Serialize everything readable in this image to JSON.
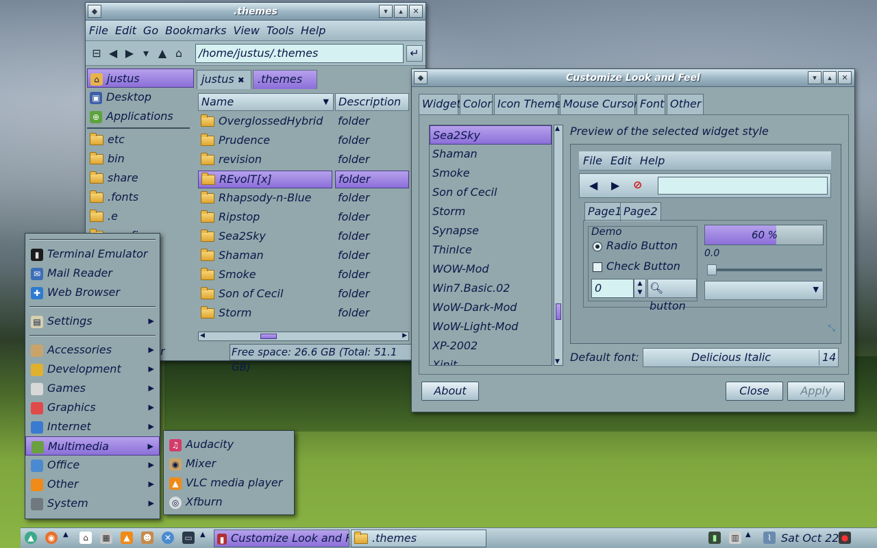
{
  "file_manager": {
    "title": ".themes",
    "menu": [
      "File",
      "Edit",
      "Go",
      "Bookmarks",
      "View",
      "Tools",
      "Help"
    ],
    "location": "/home/justus/.themes",
    "sidebar": [
      {
        "label": "justus",
        "icon": "home-folder-icon",
        "selected": true
      },
      {
        "label": "Desktop",
        "icon": "desktop-icon"
      },
      {
        "label": "Applications",
        "icon": "applications-icon"
      },
      {
        "label": "etc",
        "icon": "folder-icon"
      },
      {
        "label": "bin",
        "icon": "folder-icon"
      },
      {
        "label": "share",
        "icon": "folder-icon"
      },
      {
        "label": ".fonts",
        "icon": "folder-icon"
      },
      {
        "label": ".e",
        "icon": "folder-icon"
      },
      {
        "label": ".config",
        "icon": "folder-icon"
      }
    ],
    "tabs": [
      {
        "label": "justus",
        "close": "✖"
      },
      {
        "label": ".themes",
        "close": "✖"
      }
    ],
    "columns": {
      "name": "Name",
      "description": "Description"
    },
    "rows": [
      {
        "name": "OverglossedHybrid",
        "desc": "folder"
      },
      {
        "name": "Prudence",
        "desc": "folder"
      },
      {
        "name": "revision",
        "desc": "folder"
      },
      {
        "name": "REvolT[x]",
        "desc": "folder",
        "selected": true
      },
      {
        "name": "Rhapsody-n-Blue",
        "desc": "folder"
      },
      {
        "name": "Ripstop",
        "desc": "folder"
      },
      {
        "name": "Sea2Sky",
        "desc": "folder"
      },
      {
        "name": "Shaman",
        "desc": "folder"
      },
      {
        "name": "Smoke",
        "desc": "folder"
      },
      {
        "name": "Son of Cecil",
        "desc": "folder"
      },
      {
        "name": "Storm",
        "desc": "folder"
      }
    ],
    "status_left": "er",
    "status": "Free space: 26.6 GB (Total: 51.1 GB)"
  },
  "customize": {
    "title": "Customize Look and Feel",
    "tabs": [
      "Widget",
      "Color",
      "Icon Theme",
      "Mouse Cursor",
      "Font",
      "Other"
    ],
    "themes": [
      "Sea2Sky",
      "Shaman",
      "Smoke",
      "Son of Cecil",
      "Storm",
      "Synapse",
      "ThinIce",
      "WOW-Mod",
      "Win7.Basic.02",
      "WoW-Dark-Mod",
      "WoW-Light-Mod",
      "XP-2002",
      "Xinit"
    ],
    "preview_title": "Preview of the selected widget style",
    "preview": {
      "menu": [
        "File",
        "Edit",
        "Help"
      ],
      "tabs": [
        "Page1",
        "Page2"
      ],
      "group": "Demo",
      "radio": "Radio Button",
      "check": "Check Button",
      "spin_value": "0",
      "button": "button",
      "progress_text": "60 %",
      "progress": 0.6,
      "slider_value": "0.0"
    },
    "font_label": "Default font:",
    "font_name": "Delicious Italic",
    "font_size": "14",
    "about": "About",
    "close": "Close",
    "apply": "Apply"
  },
  "start_menu": {
    "items_top": [
      {
        "label": "Terminal Emulator",
        "icon": "terminal-icon"
      },
      {
        "label": "Mail Reader",
        "icon": "mail-icon"
      },
      {
        "label": "Web Browser",
        "icon": "browser-icon"
      }
    ],
    "settings": "Settings",
    "categories": [
      {
        "label": "Accessories",
        "icon": "accessories-icon"
      },
      {
        "label": "Development",
        "icon": "development-icon"
      },
      {
        "label": "Games",
        "icon": "games-icon"
      },
      {
        "label": "Graphics",
        "icon": "graphics-icon"
      },
      {
        "label": "Internet",
        "icon": "internet-icon"
      },
      {
        "label": "Multimedia",
        "icon": "multimedia-icon",
        "selected": true
      },
      {
        "label": "Office",
        "icon": "office-icon"
      },
      {
        "label": "Other",
        "icon": "other-icon"
      },
      {
        "label": "System",
        "icon": "system-icon"
      }
    ],
    "submenu": [
      {
        "label": "Audacity",
        "icon": "audacity-icon"
      },
      {
        "label": "Mixer",
        "icon": "mixer-icon"
      },
      {
        "label": "VLC media player",
        "icon": "vlc-icon"
      },
      {
        "label": "Xfburn",
        "icon": "xfburn-icon"
      }
    ]
  },
  "taskbar": {
    "tasks": [
      {
        "label": "Customize Look and F...",
        "icon": "customize-icon"
      },
      {
        "label": ".themes",
        "icon": "folder-icon"
      }
    ],
    "clock": "Sat Oct 22"
  },
  "colors": {
    "accent": "#8c6fd9",
    "text": "#0a1848",
    "chrome": "#93a8ac"
  }
}
